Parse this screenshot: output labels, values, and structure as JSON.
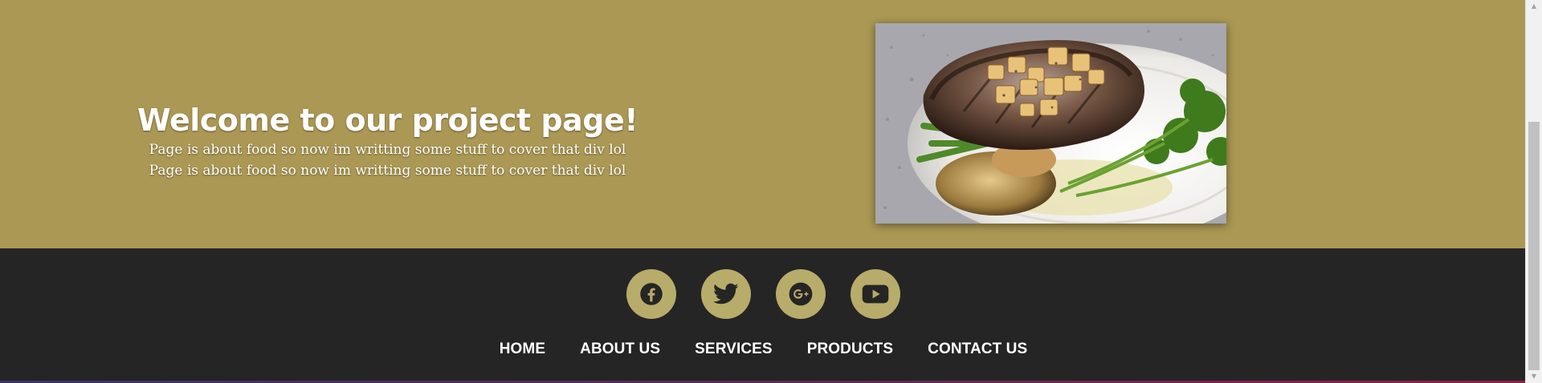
{
  "hero": {
    "title": "Welcome to our project page!",
    "lines": [
      "Page is about food so now im writting some stuff to cover that div lol",
      "Page is about food so now im writting some stuff to cover that div lol"
    ],
    "image_icon": "grilled-pork-chop-photo"
  },
  "footer": {
    "social": [
      {
        "name": "facebook",
        "icon": "facebook-icon"
      },
      {
        "name": "twitter",
        "icon": "twitter-icon"
      },
      {
        "name": "google-plus",
        "icon": "google-plus-icon"
      },
      {
        "name": "youtube",
        "icon": "youtube-icon"
      }
    ],
    "nav": [
      "HOME",
      "ABOUT US",
      "SERVICES",
      "PRODUCTS",
      "CONTACT US"
    ]
  },
  "colors": {
    "hero_background": "#ab9854",
    "footer_background": "#252525",
    "social_circle": "#b7ac6a",
    "icon_color": "#252525",
    "nav_text": "#ffffff"
  },
  "scrollbar": {
    "up_icon": "scroll-up-arrow-icon",
    "down_icon": "scroll-down-arrow-icon"
  }
}
